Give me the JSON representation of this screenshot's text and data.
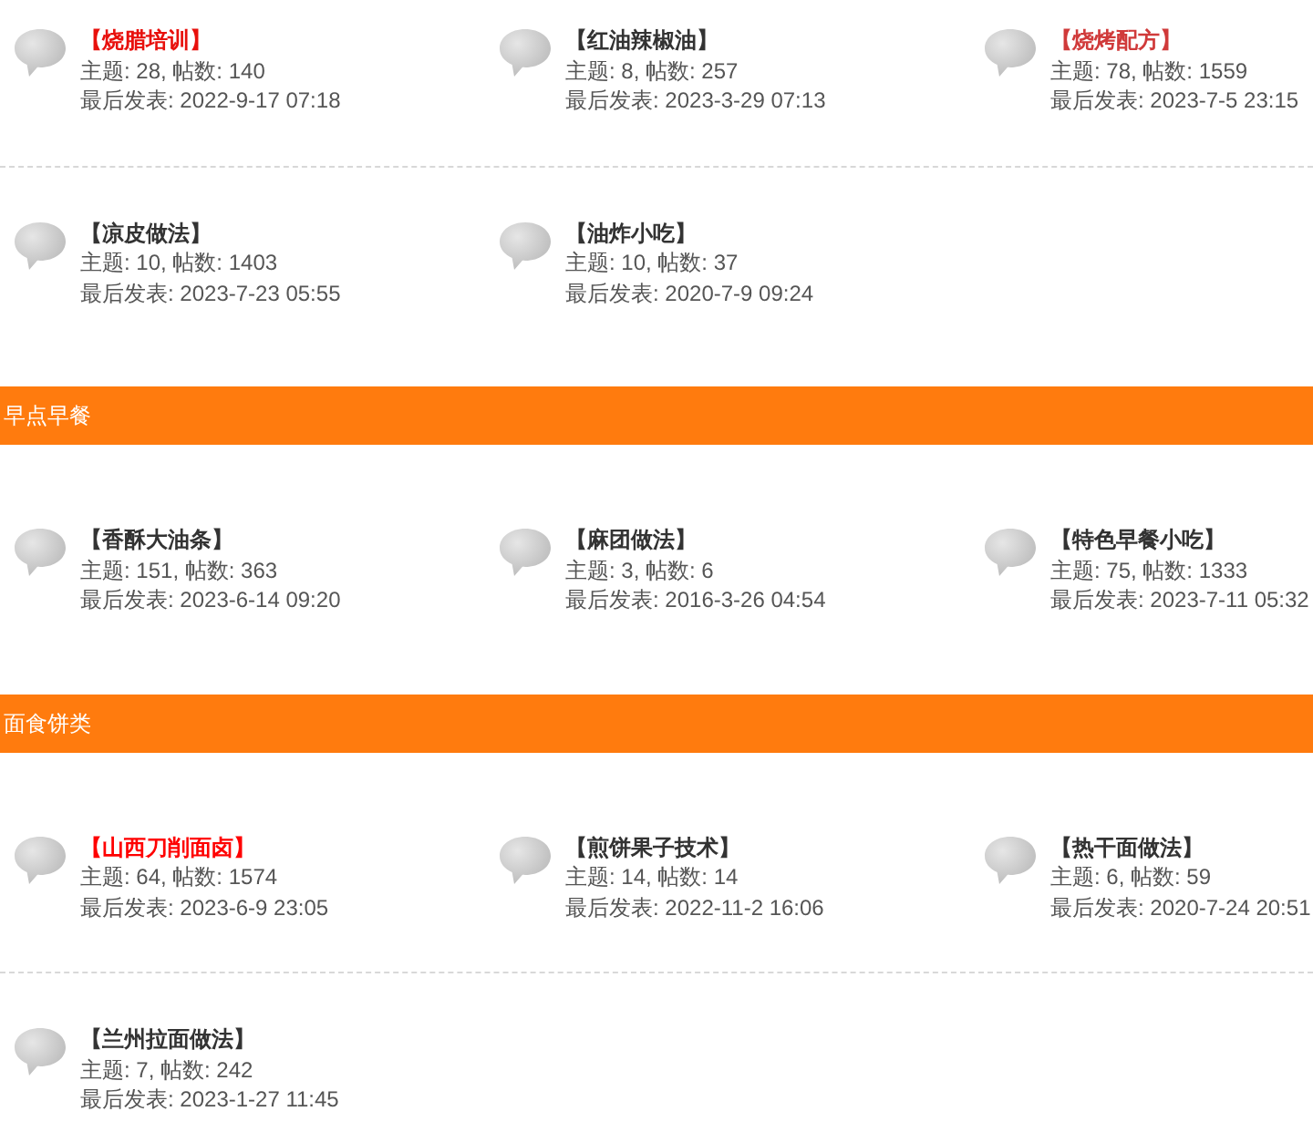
{
  "sections": [
    {
      "rows": [
        [
          {
            "name": "【烧腊培训】",
            "color": "#e8100c",
            "stats": "主题: 28, 帖数: 140",
            "last_post": "最后发表: 2022-9-17 07:18"
          },
          {
            "name": "【红油辣椒油】",
            "color": "#333333",
            "stats": "主题: 8, 帖数: 257",
            "last_post": "最后发表: 2023-3-29 07:13"
          },
          {
            "name": "【烧烤配方】",
            "color": "#d03a3a",
            "stats": "主题: 78, 帖数: 1559",
            "last_post": "最后发表: 2023-7-5 23:15"
          }
        ],
        [
          {
            "name": "【凉皮做法】",
            "color": "#333333",
            "stats": "主题: 10, 帖数: 1403",
            "last_post": "最后发表: 2023-7-23 05:55"
          },
          {
            "name": "【油炸小吃】",
            "color": "#333333",
            "stats": "主题: 10, 帖数: 37",
            "last_post": "最后发表: 2020-7-9 09:24"
          }
        ]
      ]
    },
    {
      "title": "早点早餐",
      "rows": [
        [
          {
            "name": "【香酥大油条】",
            "color": "#333333",
            "stats": "主题: 151, 帖数: 363",
            "last_post": "最后发表: 2023-6-14 09:20"
          },
          {
            "name": "【麻团做法】",
            "color": "#333333",
            "stats": "主题: 3, 帖数: 6",
            "last_post": "最后发表: 2016-3-26 04:54"
          },
          {
            "name": "【特色早餐小吃】",
            "color": "#333333",
            "stats": "主题: 75, 帖数: 1333",
            "last_post": "最后发表: 2023-7-11 05:32"
          }
        ]
      ]
    },
    {
      "title": "面食饼类",
      "rows": [
        [
          {
            "name": "【山西刀削面卤】",
            "color": "#ff0000",
            "stats": "主题: 64, 帖数: 1574",
            "last_post": "最后发表: 2023-6-9 23:05"
          },
          {
            "name": "【煎饼果子技术】",
            "color": "#333333",
            "stats": "主题: 14, 帖数: 14",
            "last_post": "最后发表: 2022-11-2 16:06"
          },
          {
            "name": "【热干面做法】",
            "color": "#333333",
            "stats": "主题: 6, 帖数: 59",
            "last_post": "最后发表: 2020-7-24 20:51"
          }
        ],
        [
          {
            "name": "【兰州拉面做法】",
            "color": "#333333",
            "stats": "主题: 7, 帖数: 242",
            "last_post": "最后发表: 2023-1-27 11:45"
          }
        ]
      ]
    }
  ]
}
